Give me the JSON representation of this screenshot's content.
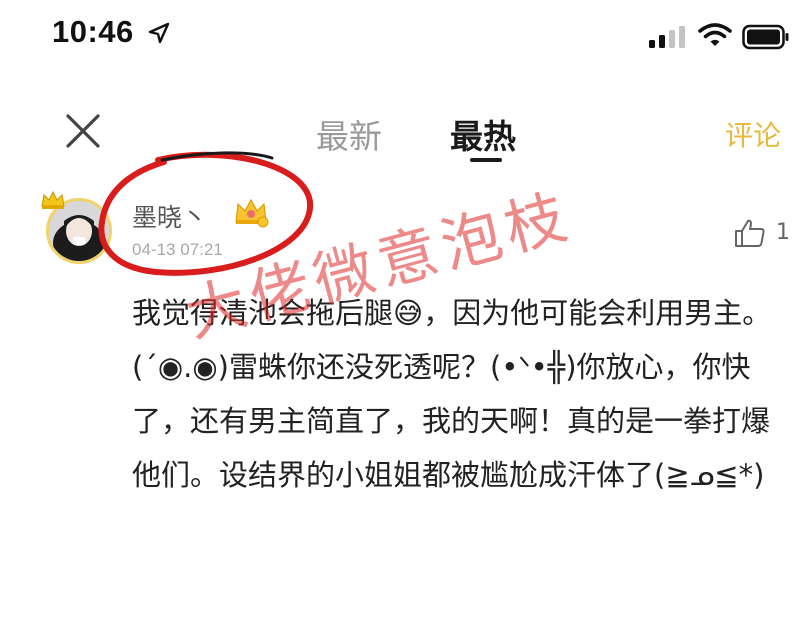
{
  "status_bar": {
    "time": "10:46",
    "icons": [
      "location-arrow-icon",
      "signal-icon",
      "wifi-icon",
      "battery-icon"
    ]
  },
  "header": {
    "close_icon": "close-icon",
    "tabs": [
      {
        "label": "最新",
        "active": false
      },
      {
        "label": "最热",
        "active": true
      }
    ],
    "comment_label": "评论"
  },
  "comment": {
    "username": "墨晓丶",
    "timestamp": "04-13 07:21",
    "likes": "1",
    "body": "我觉得清池会拖后腿😅，因为他可能会利用男主。(´◉.◉)雷蛛你还没死透呢？(•ᐠ•╬)你放心，你快了，还有男主简直了，我的天啊！真的是一拳打爆他们。设结界的小姐姐都被尴尬成汗体了(≧ᓄ≦*)"
  },
  "annotation": {
    "watermark": "大佬微意泡枝"
  },
  "colors": {
    "accent": "#e8b93e",
    "annotation_red": "#d91c1c"
  }
}
